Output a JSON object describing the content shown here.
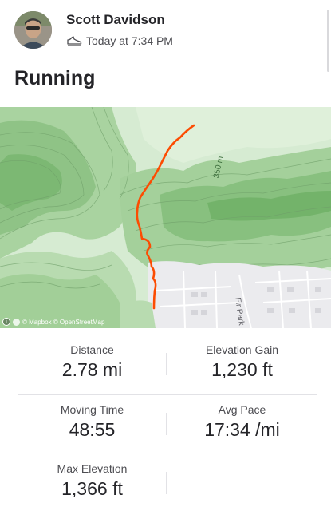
{
  "header": {
    "athlete_name": "Scott Davidson",
    "timestamp": "Today at 7:34 PM",
    "activity_icon": "shoe-icon",
    "avatar_icon": "avatar"
  },
  "activity": {
    "title": "Running"
  },
  "map": {
    "contour_label": "350 m",
    "street_label": "Fir Park",
    "attribution": "© Mapbox © OpenStreetMap",
    "route_color": "#fc4c02"
  },
  "stats": [
    {
      "label": "Distance",
      "value": "2.78 mi"
    },
    {
      "label": "Elevation Gain",
      "value": "1,230 ft"
    },
    {
      "label": "Moving Time",
      "value": "48:55"
    },
    {
      "label": "Avg Pace",
      "value": "17:34 /mi"
    },
    {
      "label": "Max Elevation",
      "value": "1,366 ft"
    }
  ]
}
